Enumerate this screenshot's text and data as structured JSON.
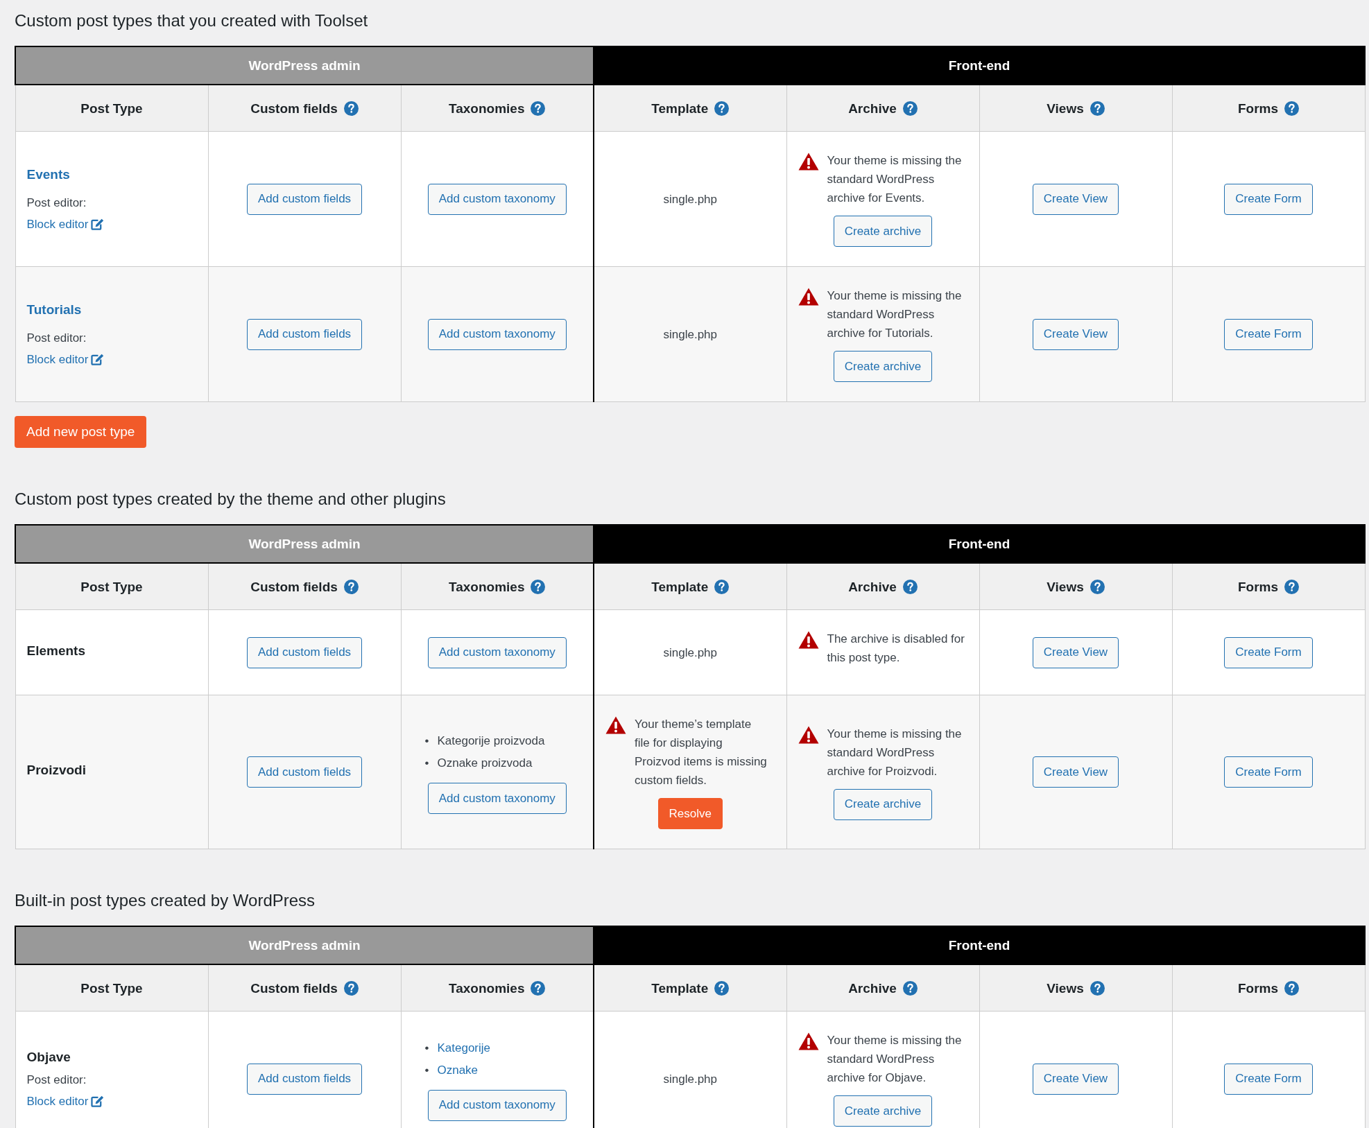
{
  "sections": [
    {
      "title": "Custom post types that you created with Toolset",
      "groups": [
        {
          "label": "WordPress admin",
          "kind": "admin",
          "columns": [
            {
              "label": "Post Type",
              "help": false
            },
            {
              "label": "Custom fields",
              "help": true
            },
            {
              "label": "Taxonomies",
              "help": true
            }
          ]
        },
        {
          "label": "Front-end",
          "kind": "frontend",
          "columns": [
            {
              "label": "Template",
              "help": true
            },
            {
              "label": "Archive",
              "help": true
            },
            {
              "label": "Views",
              "help": true
            },
            {
              "label": "Forms",
              "help": true
            }
          ]
        }
      ],
      "rows": [
        {
          "post_type": {
            "name": "Events",
            "link": true,
            "editor_label": "Post editor:",
            "editor_link": "Block editor"
          },
          "cells": [
            {
              "kind": "button",
              "button": "Add custom fields"
            },
            {
              "kind": "taxonomy",
              "button": "Add custom taxonomy"
            },
            {
              "kind": "text",
              "text": "single.php"
            },
            {
              "kind": "warning",
              "text": "Your theme is missing the standard WordPress archive for Events.",
              "button": "Create archive",
              "primary": false
            },
            {
              "kind": "button",
              "button": "Create View"
            },
            {
              "kind": "button",
              "button": "Create Form"
            }
          ]
        },
        {
          "post_type": {
            "name": "Tutorials",
            "link": true,
            "editor_label": "Post editor:",
            "editor_link": "Block editor"
          },
          "cells": [
            {
              "kind": "button",
              "button": "Add custom fields"
            },
            {
              "kind": "taxonomy",
              "button": "Add custom taxonomy"
            },
            {
              "kind": "text",
              "text": "single.php"
            },
            {
              "kind": "warning",
              "text": "Your theme is missing the standard WordPress archive for Tutorials.",
              "button": "Create archive",
              "primary": false
            },
            {
              "kind": "button",
              "button": "Create View"
            },
            {
              "kind": "button",
              "button": "Create Form"
            }
          ]
        }
      ],
      "add_button": "Add new post type"
    },
    {
      "title": "Custom post types created by the theme and other plugins",
      "groups": [
        {
          "label": "WordPress admin",
          "kind": "admin",
          "columns": [
            {
              "label": "Post Type",
              "help": false
            },
            {
              "label": "Custom fields",
              "help": true
            },
            {
              "label": "Taxonomies",
              "help": true
            }
          ]
        },
        {
          "label": "Front-end",
          "kind": "frontend",
          "columns": [
            {
              "label": "Template",
              "help": true
            },
            {
              "label": "Archive",
              "help": true
            },
            {
              "label": "Views",
              "help": true
            },
            {
              "label": "Forms",
              "help": true
            }
          ]
        }
      ],
      "rows": [
        {
          "post_type": {
            "name": "Elements",
            "link": false
          },
          "cells": [
            {
              "kind": "button",
              "button": "Add custom fields"
            },
            {
              "kind": "taxonomy",
              "button": "Add custom taxonomy"
            },
            {
              "kind": "text",
              "text": "single.php"
            },
            {
              "kind": "warning",
              "text": "The archive is disabled for this post type."
            },
            {
              "kind": "button",
              "button": "Create View"
            },
            {
              "kind": "button",
              "button": "Create Form"
            }
          ]
        },
        {
          "post_type": {
            "name": "Proizvodi",
            "link": false
          },
          "cells": [
            {
              "kind": "button",
              "button": "Add custom fields"
            },
            {
              "kind": "taxonomy",
              "items": [
                {
                  "marker": "•",
                  "label": "Kategorije proizvoda",
                  "link": false
                },
                {
                  "marker": "•",
                  "label": "Oznake proizvoda",
                  "link": false
                }
              ],
              "button": "Add custom taxonomy"
            },
            {
              "kind": "warning",
              "text": "Your theme’s template file for displaying Proizvod items is missing custom fields.",
              "button": "Resolve",
              "primary": true
            },
            {
              "kind": "warning",
              "text": "Your theme is missing the standard WordPress archive for Proizvodi.",
              "button": "Create archive",
              "primary": false
            },
            {
              "kind": "button",
              "button": "Create View"
            },
            {
              "kind": "button",
              "button": "Create Form"
            }
          ]
        }
      ]
    },
    {
      "title": "Built-in post types created by WordPress",
      "groups": [
        {
          "label": "WordPress admin",
          "kind": "admin",
          "columns": [
            {
              "label": "Post Type",
              "help": false
            },
            {
              "label": "Custom fields",
              "help": true
            },
            {
              "label": "Taxonomies",
              "help": true
            }
          ]
        },
        {
          "label": "Front-end",
          "kind": "frontend",
          "columns": [
            {
              "label": "Template",
              "help": true
            },
            {
              "label": "Archive",
              "help": true
            },
            {
              "label": "Views",
              "help": true
            },
            {
              "label": "Forms",
              "help": true
            }
          ]
        }
      ],
      "rows": [
        {
          "post_type": {
            "name": "Objave",
            "link": false,
            "editor_label": "Post editor:",
            "editor_link": "Block editor"
          },
          "cells": [
            {
              "kind": "button",
              "button": "Add custom fields"
            },
            {
              "kind": "taxonomy",
              "items": [
                {
                  "marker": "•",
                  "label": "Kategorije",
                  "link": true
                },
                {
                  "marker": "•",
                  "label": "Oznake",
                  "link": true
                }
              ],
              "button": "Add custom taxonomy"
            },
            {
              "kind": "text",
              "text": "single.php"
            },
            {
              "kind": "warning",
              "text": "Your theme is missing the standard WordPress archive for Objave.",
              "button": "Create archive",
              "primary": false
            },
            {
              "kind": "button",
              "button": "Create View"
            },
            {
              "kind": "button",
              "button": "Create Form"
            }
          ]
        }
      ]
    }
  ]
}
